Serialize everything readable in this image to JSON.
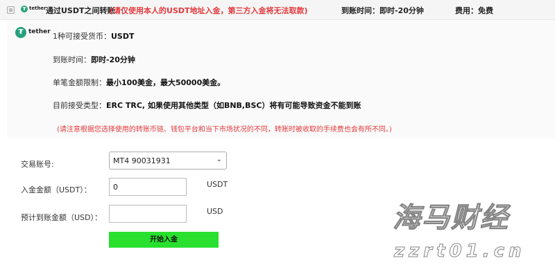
{
  "header": {
    "coin_label": "tether",
    "method_title": "通过USDT之间转账",
    "warning": "(请仅使用本人的USDT地址入金，第三方入金将无法取款)",
    "arrival_time": "到账时间：即时-20分钟",
    "fee": "费用：免费"
  },
  "details": {
    "coin_label": "tether",
    "currency_label": "1种可接受货币：",
    "currency_value": "USDT",
    "arrival_label": "到账时间：",
    "arrival_value": "即时-20分钟",
    "limit_label": "单笔金额限制：",
    "limit_value": "最小100美金，最大50000美金。",
    "types_label": "目前接受类型：",
    "types_value": "ERC TRC, 如果使用其他类型（如BNB,BSC）将有可能导致资金不能到账",
    "note": "(请注意根据您选择使用的转账币链、钱包平台和当下市场状况的不同，转账时被收取的手续费也会有所不同。)"
  },
  "form": {
    "account_label": "交易账号:",
    "account_value": "MT4 90031931",
    "deposit_label": "入金金额（USDT）：",
    "deposit_value": "0",
    "deposit_unit": "USDT",
    "estimate_label": "预计到账金额（USD）：",
    "estimate_value": "",
    "estimate_unit": "USD",
    "submit_label": "开始入金"
  },
  "watermark": {
    "brand": "海马财经",
    "domain": "zzrt01.cn"
  },
  "colors": {
    "accent_red": "#e4393c",
    "button_green": "#29e02f",
    "tether_green": "#26a17b"
  },
  "icons": {
    "tether_logo": "tether-icon",
    "select_chevron": "chevron-down-icon"
  }
}
